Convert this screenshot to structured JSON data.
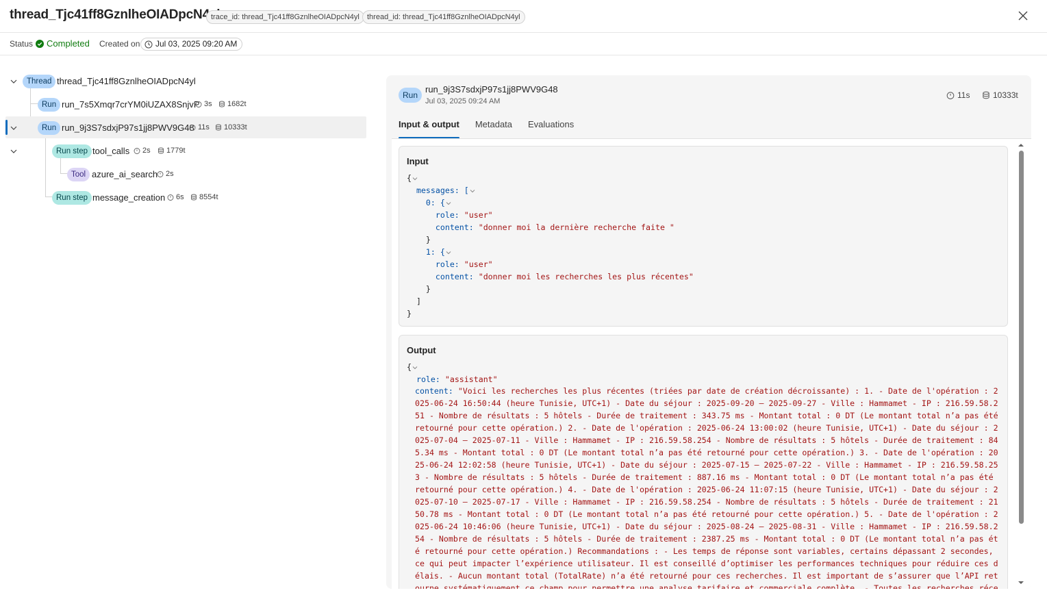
{
  "header": {
    "title": "thread_Tjc41ff8GznlheOIADpcN4yl",
    "trace_chip": "trace_id: thread_Tjc41ff8GznlheOIADpcN4yl",
    "thread_chip": "thread_id: thread_Tjc41ff8GznlheOIADpcN4yl",
    "close_icon": "close-icon"
  },
  "statusbar": {
    "status_label": "Status",
    "status_value": "Completed",
    "status_color": "#107c10",
    "created_label": "Created on",
    "created_value": "Jul 03, 2025 09:20 AM"
  },
  "tree": {
    "thread": {
      "badge": "Thread",
      "name": "thread_Tjc41ff8GznlheOIADpcN4yl"
    },
    "run1": {
      "badge": "Run",
      "name": "run_7s5Xmqr7crYM0iUZAX8SnjvP",
      "duration": "3s",
      "tokens": "1682t"
    },
    "run2": {
      "badge": "Run",
      "name": "run_9j3S7sdxjP97s1jj8PWV9G48",
      "duration": "11s",
      "tokens": "10333t"
    },
    "step1": {
      "badge": "Run step",
      "name": "tool_calls",
      "duration": "2s",
      "tokens": "1779t"
    },
    "tool": {
      "badge": "Tool",
      "name": "azure_ai_search",
      "duration": "2s"
    },
    "step2": {
      "badge": "Run step",
      "name": "message_creation",
      "duration": "6s",
      "tokens": "8554t"
    }
  },
  "detail": {
    "badge": "Run",
    "name": "run_9j3S7sdxjP97s1jj8PWV9G48",
    "date": "Jul 03, 2025 09:24 AM",
    "duration": "11s",
    "tokens": "10333t",
    "tabs": [
      "Input & output",
      "Metadata",
      "Evaluations"
    ],
    "input": {
      "title": "Input",
      "messages_key": "messages",
      "msg0_role": "\"user\"",
      "msg0_content": "\"donner moi la dernière recherche faite \"",
      "msg1_role": "\"user\"",
      "msg1_content": "\"donner moi les recherches les plus récentes\""
    },
    "output": {
      "title": "Output",
      "role": "\"assistant\"",
      "content": "\"Voici les recherches les plus récentes (triées par date de création décroissante) : 1. - Date de l'opération : 2025-06-24 16:50:44 (heure Tunisie, UTC+1) - Date du séjour : 2025-09-20 – 2025-09-27 - Ville : Hammamet - IP : 216.59.58.251 - Nombre de résultats : 5 hôtels - Durée de traitement : 343.75 ms - Montant total : 0 DT (Le montant total n’a pas été retourné pour cette opération.) 2. - Date de l'opération : 2025-06-24 13:00:02 (heure Tunisie, UTC+1) - Date du séjour : 2025-07-04 – 2025-07-11 - Ville : Hammamet - IP : 216.59.58.254 - Nombre de résultats : 5 hôtels - Durée de traitement : 845.34 ms - Montant total : 0 DT (Le montant total n’a pas été retourné pour cette opération.) 3. - Date de l'opération : 2025-06-24 12:02:58 (heure Tunisie, UTC+1) - Date du séjour : 2025-07-15 – 2025-07-22 - Ville : Hammamet - IP : 216.59.58.253 - Nombre de résultats : 5 hôtels - Durée de traitement : 887.16 ms - Montant total : 0 DT (Le montant total n’a pas été retourné pour cette opération.) 4. - Date de l'opération : 2025-06-24 11:07:15 (heure Tunisie, UTC+1) - Date du séjour : 2025-07-10 – 2025-07-17 - Ville : Hammamet - IP : 216.59.58.254 - Nombre de résultats : 5 hôtels - Durée de traitement : 2150.78 ms - Montant total : 0 DT (Le montant total n’a pas été retourné pour cette opération.) 5. - Date de l'opération : 2025-06-24 10:46:06 (heure Tunisie, UTC+1) - Date du séjour : 2025-08-24 – 2025-08-31 - Ville : Hammamet - IP : 216.59.58.254 - Nombre de résultats : 5 hôtels - Durée de traitement : 2387.25 ms - Montant total : 0 DT (Le montant total n’a pas été retourné pour cette opération.) Recommandations : - Les temps de réponse sont variables, certains dépassant 2 secondes, ce qui peut impacter l’expérience utilisateur. Il est conseillé d’optimiser les performances techniques pour réduire ces délais. - Aucun montant total (TotalRate) n’a été retourné pour ces recherches. Il est important de s’assurer que l’API retourne systématiquement ce champ pour permettre une analyse tarifaire et commerciale complète. - Toutes les recherches récentes concernent la"
    }
  }
}
